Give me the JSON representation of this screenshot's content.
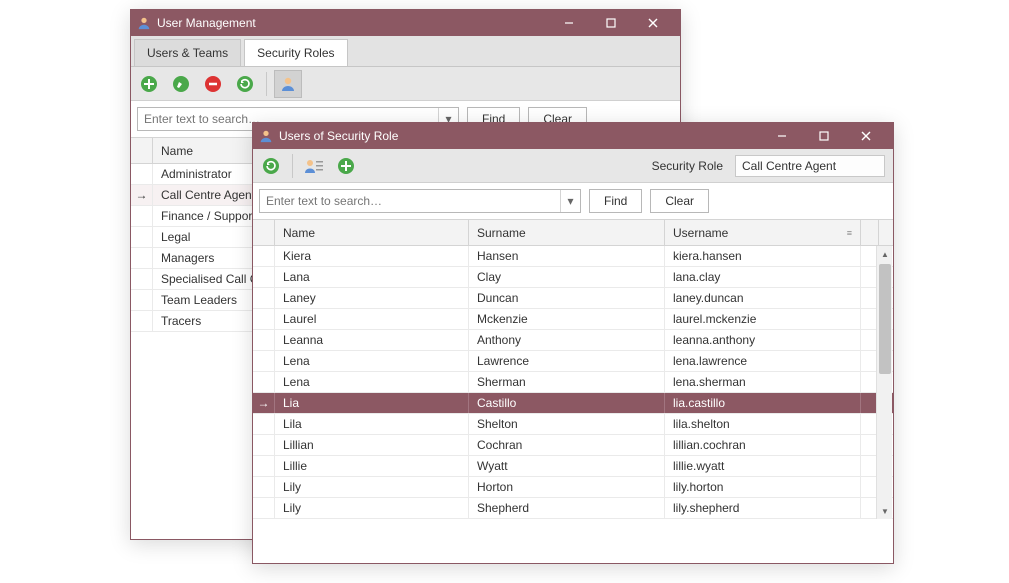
{
  "win1": {
    "title": "User Management",
    "tabs": [
      "Users & Teams",
      "Security Roles"
    ],
    "active_tab": 1,
    "search_placeholder": "Enter text to search…",
    "find_label": "Find",
    "clear_label": "Clear",
    "columns": [
      "Name"
    ],
    "selected_index": 1,
    "rows": [
      "Administrator",
      "Call Centre Agent",
      "Finance / Support",
      "Legal",
      "Managers",
      "Specialised Call Centre Agent",
      "Team Leaders",
      "Tracers"
    ]
  },
  "win2": {
    "title": "Users of Security Role",
    "role_label": "Security Role",
    "role_value": "Call Centre Agent",
    "search_placeholder": "Enter text to search…",
    "find_label": "Find",
    "clear_label": "Clear",
    "columns": [
      "Name",
      "Surname",
      "Username"
    ],
    "sort_col": 2,
    "selected_index": 7,
    "rows": [
      {
        "name": "Kiera",
        "surname": "Hansen",
        "username": "kiera.hansen"
      },
      {
        "name": "Lana",
        "surname": "Clay",
        "username": "lana.clay"
      },
      {
        "name": "Laney",
        "surname": "Duncan",
        "username": "laney.duncan"
      },
      {
        "name": "Laurel",
        "surname": "Mckenzie",
        "username": "laurel.mckenzie"
      },
      {
        "name": "Leanna",
        "surname": "Anthony",
        "username": "leanna.anthony"
      },
      {
        "name": "Lena",
        "surname": "Lawrence",
        "username": "lena.lawrence"
      },
      {
        "name": "Lena",
        "surname": "Sherman",
        "username": "lena.sherman"
      },
      {
        "name": "Lia",
        "surname": "Castillo",
        "username": "lia.castillo"
      },
      {
        "name": "Lila",
        "surname": "Shelton",
        "username": "lila.shelton"
      },
      {
        "name": "Lillian",
        "surname": "Cochran",
        "username": "lillian.cochran"
      },
      {
        "name": "Lillie",
        "surname": "Wyatt",
        "username": "lillie.wyatt"
      },
      {
        "name": "Lily",
        "surname": "Horton",
        "username": "lily.horton"
      },
      {
        "name": "Lily",
        "surname": "Shepherd",
        "username": "lily.shepherd"
      }
    ]
  },
  "icons": {
    "add": "add-icon",
    "edit": "edit-icon",
    "delete": "delete-icon",
    "refresh": "refresh-icon",
    "user": "user-icon",
    "user_list": "user-list-icon"
  }
}
